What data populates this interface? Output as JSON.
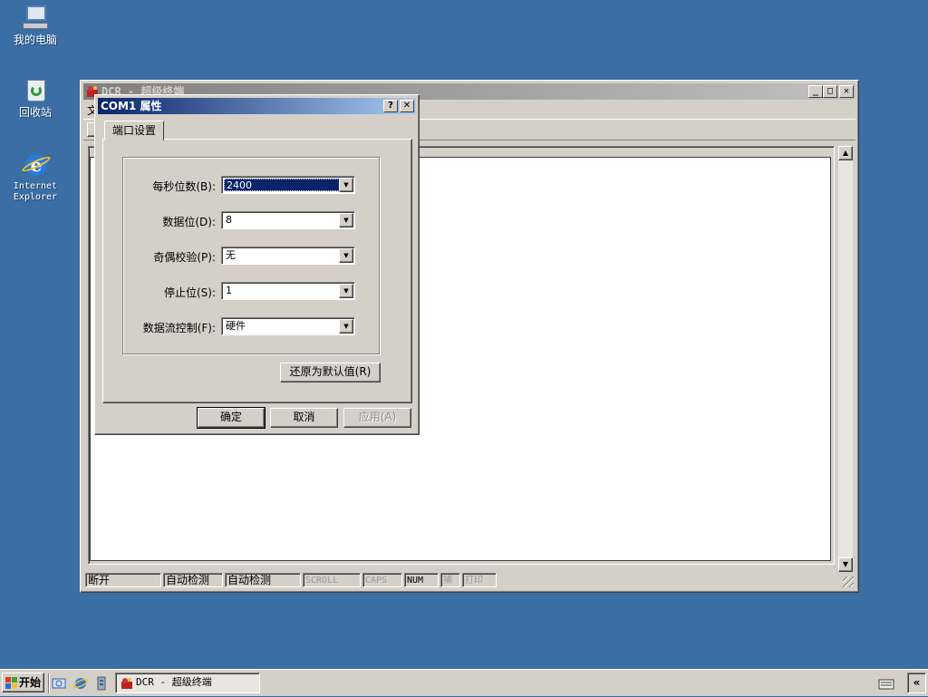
{
  "desktop": {
    "icons": [
      {
        "label": "我的电脑",
        "icon": "my-computer-icon"
      },
      {
        "label": "回收站",
        "icon": "recycle-bin-icon"
      },
      {
        "label": "Internet Explorer",
        "icon": "internet-explorer-icon"
      }
    ]
  },
  "main_window": {
    "title": "DCR - 超级终端",
    "menu_fragment": "文",
    "toolbar_fragment": "",
    "status": [
      "断开",
      "自动检测",
      "自动检测",
      "SCROLL",
      "CAPS",
      "NUM",
      "捕",
      "打印"
    ]
  },
  "dialog": {
    "title": "COM1 属性",
    "help_label": "?",
    "close_label": "✕",
    "tab": "端口设置",
    "fields": [
      {
        "label": "每秒位数(B):",
        "value": "2400",
        "selected": true
      },
      {
        "label": "数据位(D):",
        "value": "8"
      },
      {
        "label": "奇偶校验(P):",
        "value": "无"
      },
      {
        "label": "停止位(S):",
        "value": "1"
      },
      {
        "label": "数据流控制(F):",
        "value": "硬件"
      }
    ],
    "restore_defaults": "还原为默认值(R)",
    "ok": "确定",
    "cancel": "取消",
    "apply": "应用(A)"
  },
  "taskbar": {
    "start": "开始",
    "task": "DCR - 超级终端",
    "tray_expand": "«"
  },
  "colors": {
    "desktop": "#3a6ea5",
    "title_active": "#0a246a",
    "title_inactive": "#808080",
    "face": "#d4d0c8"
  }
}
